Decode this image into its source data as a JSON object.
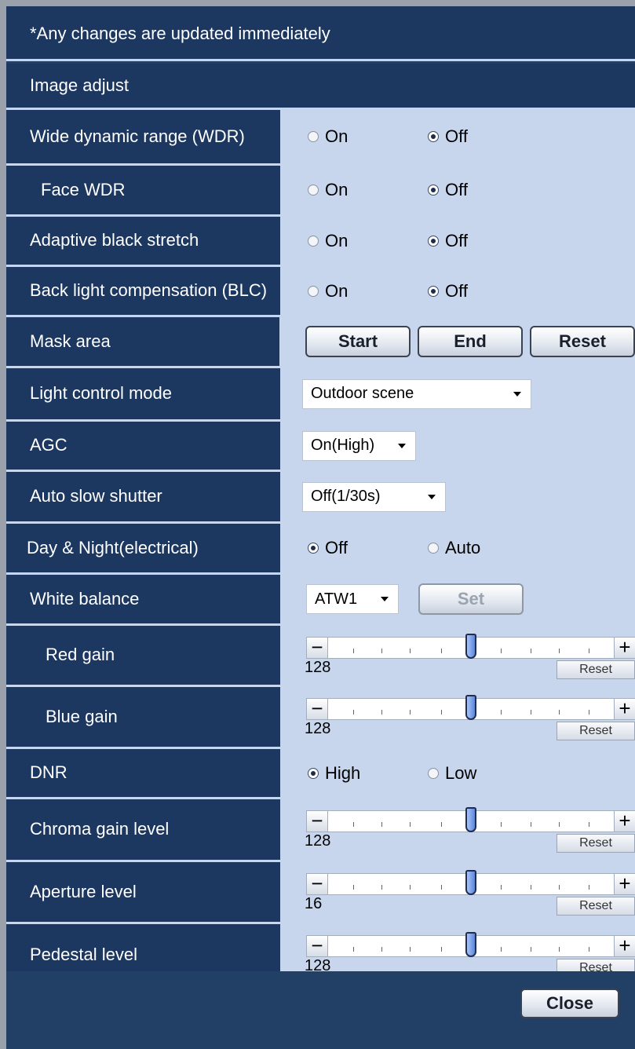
{
  "notice": "*Any changes are updated immediately",
  "section_title": "Image adjust",
  "rows": {
    "wdr": {
      "label": "Wide dynamic range (WDR)",
      "on": "On",
      "off": "Off",
      "selected": "Off"
    },
    "face_wdr": {
      "label": "Face WDR",
      "on": "On",
      "off": "Off",
      "selected": "Off"
    },
    "abs": {
      "label": "Adaptive black stretch",
      "on": "On",
      "off": "Off",
      "selected": "Off"
    },
    "blc": {
      "label": "Back light compensation (BLC)",
      "on": "On",
      "off": "Off",
      "selected": "Off"
    },
    "mask": {
      "label": "Mask area",
      "start": "Start",
      "end": "End",
      "reset": "Reset"
    },
    "light": {
      "label": "Light control mode",
      "value": "Outdoor scene"
    },
    "agc": {
      "label": "AGC",
      "value": "On(High)"
    },
    "ass": {
      "label": "Auto slow shutter",
      "value": "Off(1/30s)"
    },
    "daynight": {
      "label": "Day & Night(electrical)",
      "off": "Off",
      "auto": "Auto",
      "selected": "Off"
    },
    "wb": {
      "label": "White balance",
      "value": "ATW1",
      "set": "Set"
    },
    "red": {
      "label": "Red gain",
      "value": "128",
      "level": 0.5,
      "reset": "Reset"
    },
    "blue": {
      "label": "Blue gain",
      "value": "128",
      "level": 0.5,
      "reset": "Reset"
    },
    "dnr": {
      "label": "DNR",
      "high": "High",
      "low": "Low",
      "selected": "High"
    },
    "chroma": {
      "label": "Chroma gain level",
      "value": "128",
      "level": 0.5,
      "reset": "Reset"
    },
    "aperture": {
      "label": "Aperture level",
      "value": "16",
      "level": 0.5,
      "reset": "Reset"
    },
    "pedestal": {
      "label": "Pedestal level",
      "value": "128",
      "level": 0.5,
      "reset": "Reset"
    }
  },
  "close": "Close",
  "icons": {
    "minus": "−",
    "plus": "+"
  }
}
